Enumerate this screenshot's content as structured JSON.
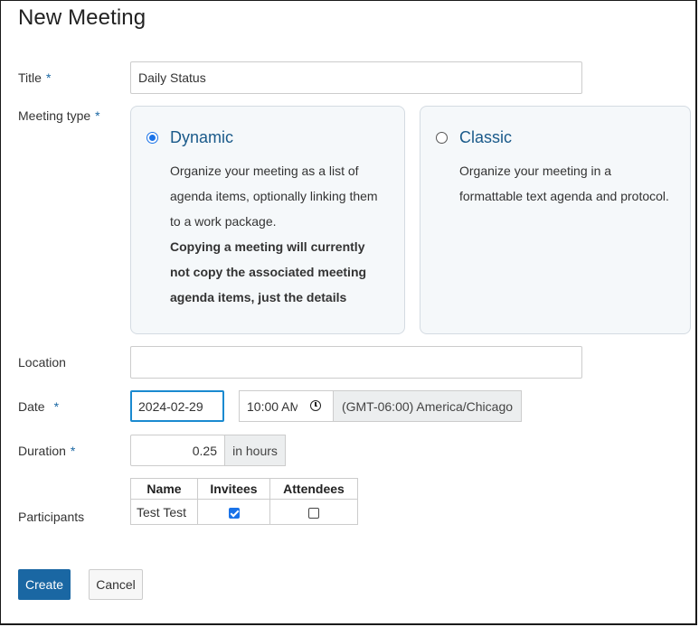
{
  "page": {
    "title": "New Meeting"
  },
  "colors": {
    "primary": "#1a67a3",
    "required_marker": "#1a67a3",
    "radio_checked": "#1a73e8",
    "card_background": "#f5f8fa",
    "card_title": "#1a5a8a"
  },
  "form": {
    "title": {
      "label": "Title",
      "required": "*",
      "value": "Daily Status"
    },
    "meeting_type": {
      "label": "Meeting type",
      "required": "*",
      "options": [
        {
          "title": "Dynamic",
          "selected": true,
          "description": "Organize your meeting as a list of agenda items, optionally linking them to a work package.",
          "note": "Copying a meeting will currently not copy the associated meeting agenda items, just the details"
        },
        {
          "title": "Classic",
          "selected": false,
          "description": "Organize your meeting in a formattable text agenda and protocol."
        }
      ]
    },
    "location": {
      "label": "Location",
      "value": ""
    },
    "date": {
      "label": "Date",
      "required": "*",
      "value": "2024-02-29",
      "time": "10:00 AM",
      "timezone": "(GMT-06:00) America/Chicago"
    },
    "duration": {
      "label": "Duration",
      "required": "*",
      "value": "0.25",
      "unit": "in hours"
    },
    "participants": {
      "label": "Participants",
      "columns": [
        "Name",
        "Invitees",
        "Attendees"
      ],
      "rows": [
        {
          "name": "Test Test",
          "invitee": true,
          "attendee": false
        }
      ]
    }
  },
  "actions": {
    "create_label": "Create",
    "cancel_label": "Cancel"
  },
  "icons": {
    "time": "clock-icon",
    "radio_selected": "radio-checked-icon",
    "radio_unselected": "radio-unchecked-icon"
  }
}
